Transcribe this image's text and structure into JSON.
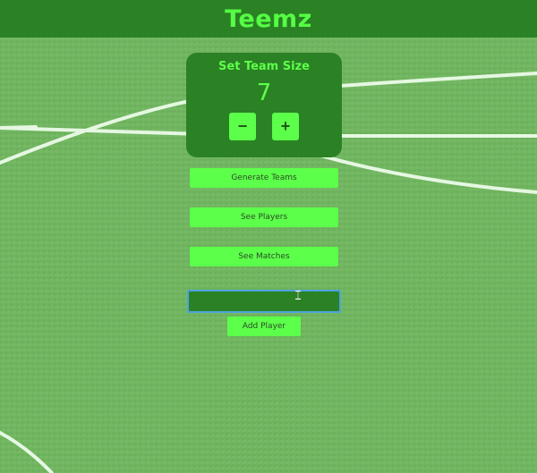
{
  "header": {
    "title": "Teemz"
  },
  "team_size": {
    "title": "Set Team Size",
    "value": "7",
    "decrement_label": "−",
    "increment_label": "+"
  },
  "actions": {
    "generate_label": "Generate Teams",
    "players_label": "See Players",
    "matches_label": "See Matches"
  },
  "player_form": {
    "input_value": "",
    "add_label": "Add Player"
  },
  "colors": {
    "header_bg": "#2a8225",
    "accent": "#5cff4a",
    "title_text": "#55ff44",
    "input_focus_border": "#4da3e0"
  },
  "icons": {
    "background": "soccer-pitch-grass",
    "cursor": "text-cursor-icon"
  }
}
